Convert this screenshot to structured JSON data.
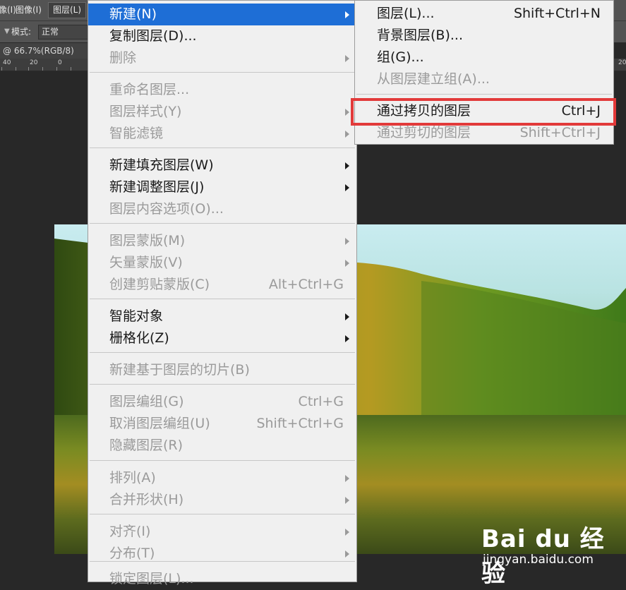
{
  "menubar": {
    "items": [
      {
        "label": "像(I)"
      },
      {
        "label": "图像(I)"
      },
      {
        "label": "图层(L)"
      }
    ]
  },
  "options_bar": {
    "mode_label": "模式:",
    "mode_value": "正常"
  },
  "document": {
    "tab_title": "@ 66.7%(RGB/8)"
  },
  "ruler": {
    "ticks": [
      "40",
      "20",
      "0"
    ],
    "right_tick": "20"
  },
  "main_menu": {
    "items": [
      {
        "label": "新建(N)",
        "shortcut": "",
        "submenu": true,
        "disabled": false,
        "highlight": true
      },
      {
        "label": "复制图层(D)...",
        "shortcut": "",
        "submenu": false,
        "disabled": false
      },
      {
        "label": "删除",
        "shortcut": "",
        "submenu": true,
        "disabled": true
      },
      {
        "label": "重命名图层...",
        "shortcut": "",
        "submenu": false,
        "disabled": true
      },
      {
        "label": "图层样式(Y)",
        "shortcut": "",
        "submenu": true,
        "disabled": true
      },
      {
        "label": "智能滤镜",
        "shortcut": "",
        "submenu": true,
        "disabled": true
      },
      {
        "label": "新建填充图层(W)",
        "shortcut": "",
        "submenu": true,
        "disabled": false
      },
      {
        "label": "新建调整图层(J)",
        "shortcut": "",
        "submenu": true,
        "disabled": false
      },
      {
        "label": "图层内容选项(O)...",
        "shortcut": "",
        "submenu": false,
        "disabled": true
      },
      {
        "label": "图层蒙版(M)",
        "shortcut": "",
        "submenu": true,
        "disabled": true
      },
      {
        "label": "矢量蒙版(V)",
        "shortcut": "",
        "submenu": true,
        "disabled": true
      },
      {
        "label": "创建剪贴蒙版(C)",
        "shortcut": "Alt+Ctrl+G",
        "submenu": false,
        "disabled": true
      },
      {
        "label": "智能对象",
        "shortcut": "",
        "submenu": true,
        "disabled": false
      },
      {
        "label": "栅格化(Z)",
        "shortcut": "",
        "submenu": true,
        "disabled": false
      },
      {
        "label": "新建基于图层的切片(B)",
        "shortcut": "",
        "submenu": false,
        "disabled": true
      },
      {
        "label": "图层编组(G)",
        "shortcut": "Ctrl+G",
        "submenu": false,
        "disabled": true
      },
      {
        "label": "取消图层编组(U)",
        "shortcut": "Shift+Ctrl+G",
        "submenu": false,
        "disabled": true
      },
      {
        "label": "隐藏图层(R)",
        "shortcut": "",
        "submenu": false,
        "disabled": true
      },
      {
        "label": "排列(A)",
        "shortcut": "",
        "submenu": true,
        "disabled": true
      },
      {
        "label": "合并形状(H)",
        "shortcut": "",
        "submenu": true,
        "disabled": true
      },
      {
        "label": "对齐(I)",
        "shortcut": "",
        "submenu": true,
        "disabled": true
      },
      {
        "label": "分布(T)",
        "shortcut": "",
        "submenu": true,
        "disabled": true
      },
      {
        "label": "锁定图层(L)...",
        "shortcut": "",
        "submenu": false,
        "disabled": true
      }
    ]
  },
  "new_submenu": {
    "items": [
      {
        "label": "图层(L)...",
        "shortcut": "Shift+Ctrl+N",
        "disabled": false
      },
      {
        "label": "背景图层(B)...",
        "shortcut": "",
        "disabled": false
      },
      {
        "label": "组(G)...",
        "shortcut": "",
        "disabled": false
      },
      {
        "label": "从图层建立组(A)...",
        "shortcut": "",
        "disabled": true
      },
      {
        "label": "通过拷贝的图层",
        "shortcut": "Ctrl+J",
        "disabled": false
      },
      {
        "label": "通过剪切的图层",
        "shortcut": "Shift+Ctrl+J",
        "disabled": true
      }
    ]
  },
  "watermark": {
    "brand": "Bai du 经验",
    "url": "jingyan.baidu.com"
  },
  "colors": {
    "highlight": "#1e6ed6",
    "callout": "#e23a3a",
    "menu_bg": "#f0f0f0"
  }
}
